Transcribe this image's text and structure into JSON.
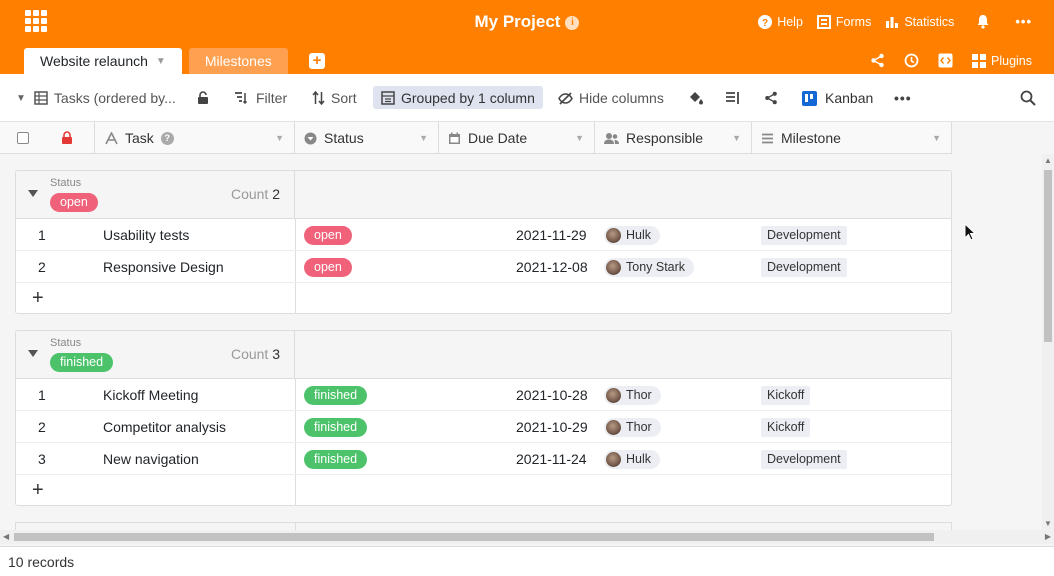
{
  "header": {
    "project_title": "My Project",
    "info_glyph": "i",
    "help": "Help",
    "forms": "Forms",
    "statistics": "Statistics",
    "plugins": "Plugins",
    "more": "•••",
    "brand_color": "#ff8000",
    "tabs": [
      {
        "label": "Website relaunch",
        "active": true
      },
      {
        "label": "Milestones",
        "active": false
      }
    ]
  },
  "toolbar": {
    "view": "Tasks (ordered by...",
    "filter": "Filter",
    "sort": "Sort",
    "group": "Grouped by 1 column",
    "hide": "Hide columns",
    "kanban": "Kanban",
    "more": "•••"
  },
  "columns": [
    "Task",
    "Status",
    "Due Date",
    "Responsible",
    "Milestone"
  ],
  "groups": [
    {
      "label": "Status",
      "value": "open",
      "color": "#f0627a",
      "count_label": "Count",
      "count": "2",
      "rows": [
        {
          "n": "1",
          "task": "Usability tests",
          "status": "open",
          "due": "2021-11-29",
          "person": "Hulk",
          "milestone": "Development"
        },
        {
          "n": "2",
          "task": "Responsive Design",
          "status": "open",
          "due": "2021-12-08",
          "person": "Tony Stark",
          "milestone": "Development"
        }
      ]
    },
    {
      "label": "Status",
      "value": "finished",
      "color": "#4cc36b",
      "count_label": "Count",
      "count": "3",
      "rows": [
        {
          "n": "1",
          "task": "Kickoff Meeting",
          "status": "finished",
          "due": "2021-10-28",
          "person": "Thor",
          "milestone": "Kickoff"
        },
        {
          "n": "2",
          "task": "Competitor analysis",
          "status": "finished",
          "due": "2021-10-29",
          "person": "Thor",
          "milestone": "Kickoff"
        },
        {
          "n": "3",
          "task": "New navigation",
          "status": "finished",
          "due": "2021-11-24",
          "person": "Hulk",
          "milestone": "Development"
        }
      ]
    }
  ],
  "footer": {
    "records": "10 records"
  }
}
